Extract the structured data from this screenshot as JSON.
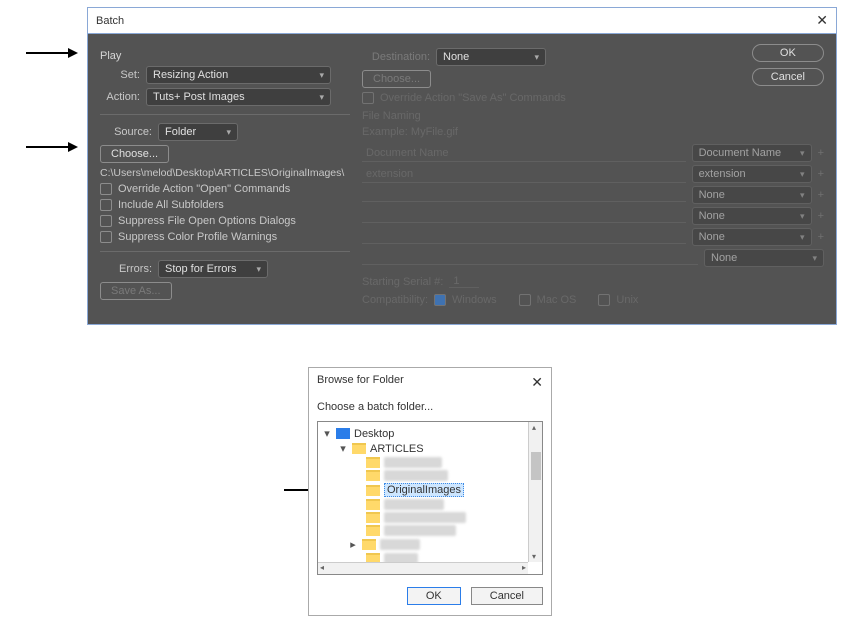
{
  "batch": {
    "title": "Batch",
    "play_section": "Play",
    "set_label": "Set:",
    "set_value": "Resizing Action",
    "action_label": "Action:",
    "action_value": "Tuts+ Post Images",
    "source_label": "Source:",
    "source_value": "Folder",
    "choose_btn": "Choose...",
    "chosen_path": "C:\\Users\\melod\\Desktop\\ARTICLES\\OriginalImages\\",
    "chk_override_open": "Override Action \"Open\" Commands",
    "chk_include_sub": "Include All Subfolders",
    "chk_suppress_dialogs": "Suppress File Open Options Dialogs",
    "chk_suppress_profile": "Suppress Color Profile Warnings",
    "errors_label": "Errors:",
    "errors_value": "Stop for Errors",
    "save_as_btn": "Save As...",
    "destination_label": "Destination:",
    "destination_value": "None",
    "dest_choose_btn": "Choose...",
    "chk_override_save": "Override Action \"Save As\" Commands",
    "file_naming": "File Naming",
    "example_label": "Example: MyFile.gif",
    "fn_field_doc": "Document Name",
    "fn_sel_doc": "Document Name",
    "fn_field_ext": "extension",
    "fn_sel_ext": "extension",
    "fn_sel_none": "None",
    "starting_serial_label": "Starting Serial #:",
    "starting_serial_value": "1",
    "compat_label": "Compatibility:",
    "compat_win": "Windows",
    "compat_mac": "Mac OS",
    "compat_unix": "Unix",
    "ok": "OK",
    "cancel": "Cancel"
  },
  "browse": {
    "title": "Browse for Folder",
    "subtitle": "Choose a batch folder...",
    "desktop": "Desktop",
    "articles": "ARTICLES",
    "original": "OriginalImages",
    "ok": "OK",
    "cancel": "Cancel"
  }
}
